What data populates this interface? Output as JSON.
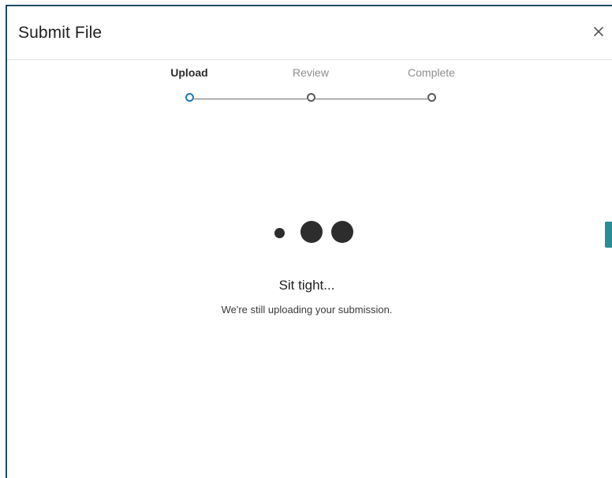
{
  "dialog": {
    "title": "Submit File",
    "close_label": "×"
  },
  "stepper": {
    "steps": [
      {
        "label": "Upload",
        "state": "active"
      },
      {
        "label": "Review",
        "state": "inactive"
      },
      {
        "label": "Complete",
        "state": "inactive"
      }
    ]
  },
  "loading": {
    "heading": "Sit tight...",
    "message": "We're still uploading your submission."
  },
  "icons": {
    "close": "close-icon",
    "loading": "loading-dots-icon"
  },
  "colors": {
    "frame_border": "#1b4b5f",
    "active_step": "#1d78b6",
    "accent_tab": "#2a8c94"
  }
}
